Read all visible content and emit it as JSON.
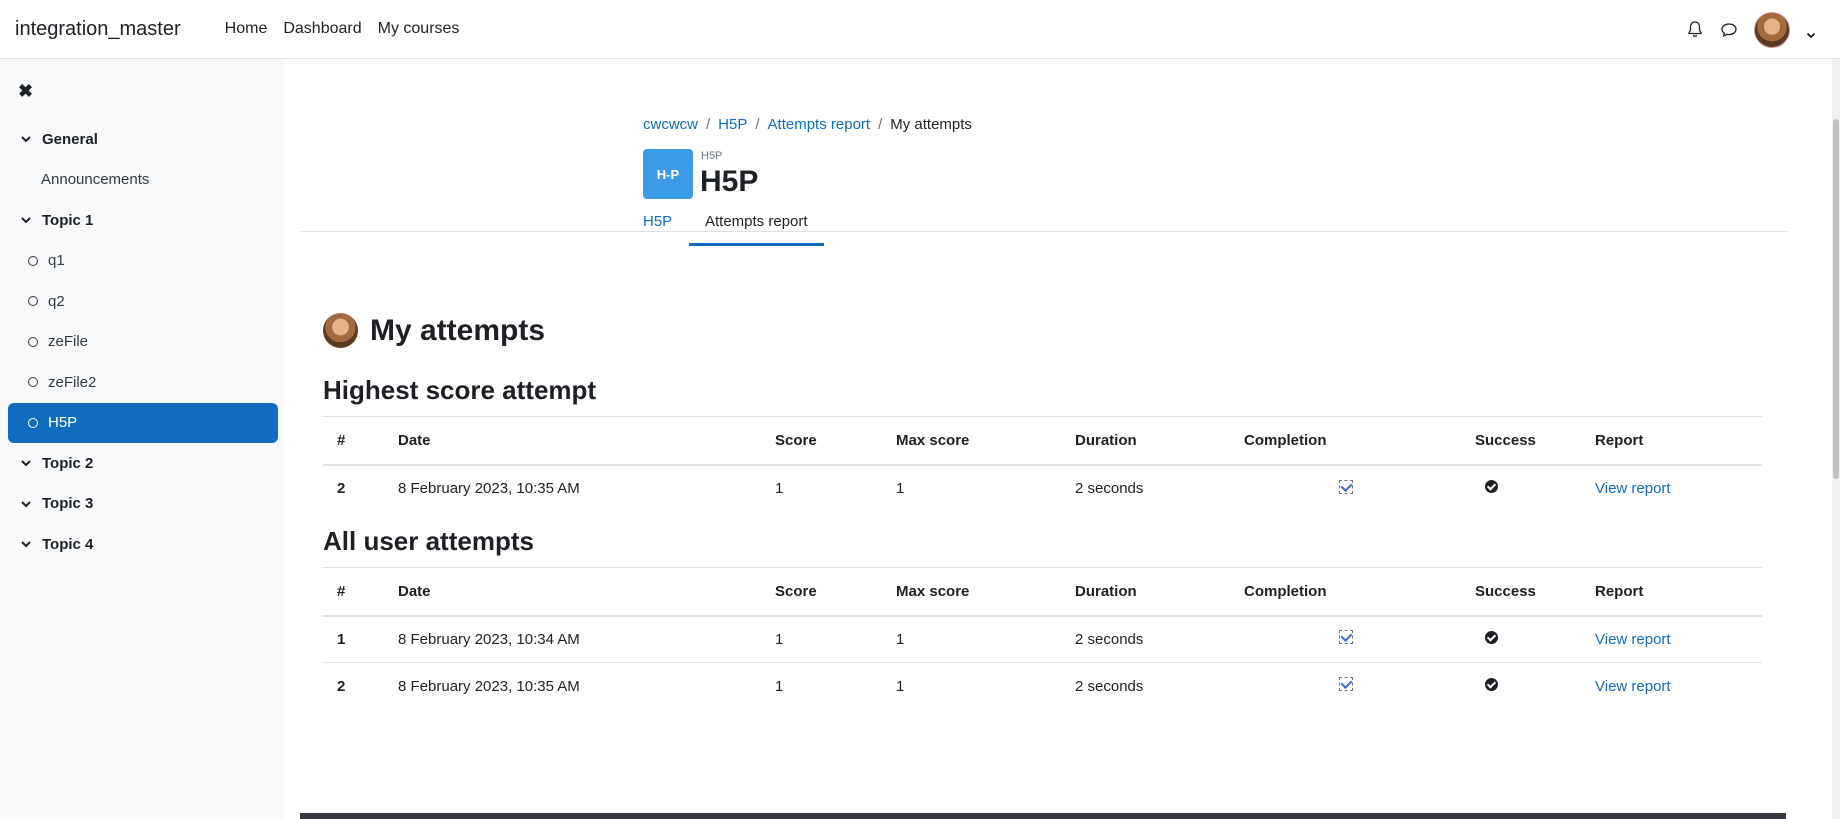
{
  "site": {
    "name": "integration_master"
  },
  "primary_nav": [
    "Home",
    "Dashboard",
    "My courses"
  ],
  "icons": {
    "close": "close-icon",
    "notifications": "bell-icon",
    "messages": "chat-icon",
    "user_menu": "chevron-down-icon"
  },
  "drawer": {
    "items": [
      {
        "type": "section",
        "label": "General"
      },
      {
        "type": "sub",
        "label": "Announcements"
      },
      {
        "type": "section",
        "label": "Topic 1"
      },
      {
        "type": "act",
        "label": "q1"
      },
      {
        "type": "act",
        "label": "q2"
      },
      {
        "type": "act",
        "label": "zeFile"
      },
      {
        "type": "act",
        "label": "zeFile2"
      },
      {
        "type": "act",
        "label": "H5P",
        "active": true
      },
      {
        "type": "section",
        "label": "Topic 2"
      },
      {
        "type": "section",
        "label": "Topic 3"
      },
      {
        "type": "section",
        "label": "Topic 4"
      }
    ]
  },
  "breadcrumb": [
    "cwcwcw",
    "H5P",
    "Attempts report",
    "My attempts"
  ],
  "module": {
    "icon_text": "H-P",
    "type": "H5P",
    "title": "H5P"
  },
  "tabs": [
    "H5P",
    "Attempts report"
  ],
  "page_title": "My attempts",
  "highest_heading": "Highest score attempt",
  "all_heading": "All user attempts",
  "columns": [
    "#",
    "Date",
    "Score",
    "Max score",
    "Duration",
    "Completion",
    "Success",
    "Report"
  ],
  "highest_rows": [
    {
      "num": "2",
      "date": "8 February 2023, 10:35 AM",
      "score": "1",
      "max": "1",
      "duration": "2 seconds",
      "report": "View report"
    }
  ],
  "all_rows": [
    {
      "num": "1",
      "date": "8 February 2023, 10:34 AM",
      "score": "1",
      "max": "1",
      "duration": "2 seconds",
      "report": "View report"
    },
    {
      "num": "2",
      "date": "8 February 2023, 10:35 AM",
      "score": "1",
      "max": "1",
      "duration": "2 seconds",
      "report": "View report"
    }
  ],
  "colors": {
    "primary": "#0f6cbf",
    "h5p_blue": "#3d9ce8",
    "drawer_bg": "#f8f9fa"
  }
}
